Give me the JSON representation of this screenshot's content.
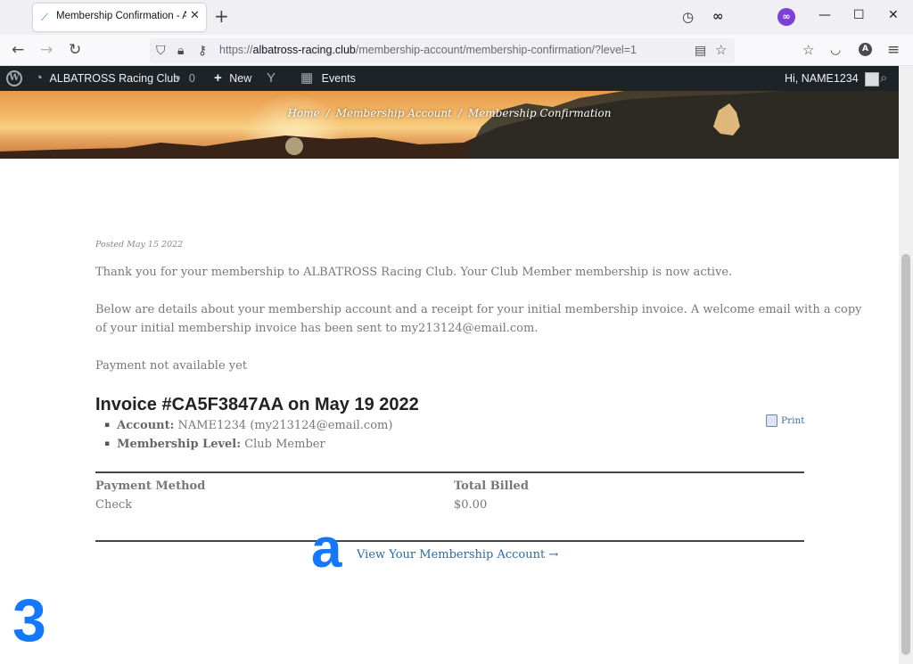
{
  "browser": {
    "tab_title": "Membership Confirmation - ALBATROSS",
    "tab_favicon": "feather-icon",
    "url_scheme": "https://",
    "url_host": "albatross-racing.club",
    "url_path": "/membership-account/membership-confirmation/?level=1",
    "extension_badge": "∞",
    "profile_letter": "A"
  },
  "adminbar": {
    "site_name": "ALBATROSS Racing Club",
    "comments_count": "0",
    "new_label": "New",
    "events_label": "Events",
    "greeting": "Hi, NAME1234"
  },
  "breadcrumb": {
    "items": [
      "Home",
      "Membership Account",
      "Membership Confirmation"
    ],
    "separator": "/"
  },
  "content": {
    "posted": "Posted May 15 2022",
    "thank_you": "Thank you for your membership to ALBATROSS Racing Club. Your Club Member membership is now active.",
    "details_line1": "Below are details about your membership account and a receipt for your initial membership invoice. A welcome email with a copy",
    "details_line2": "of your initial membership invoice has been sent to my213124@email.com.",
    "payment_status": "Payment not available yet",
    "invoice_title": "Invoice #CA5F3847AA on May 19 2022",
    "account_label": "Account:",
    "account_value": "NAME1234 (my213124@email.com)",
    "level_label": "Membership Level:",
    "level_value": "Club Member",
    "print_label": "Print",
    "payment_method_header": "Payment Method",
    "payment_method_value": "Check",
    "total_header": "Total Billed",
    "total_value": "$0.00",
    "account_link": "View Your Membership Account →"
  },
  "overlay": {
    "letter_mark": "a",
    "number_mark": "3"
  },
  "colors": {
    "link": "#2a6aa5",
    "adminbar": "#1d2327",
    "mark": "#1478ff"
  }
}
